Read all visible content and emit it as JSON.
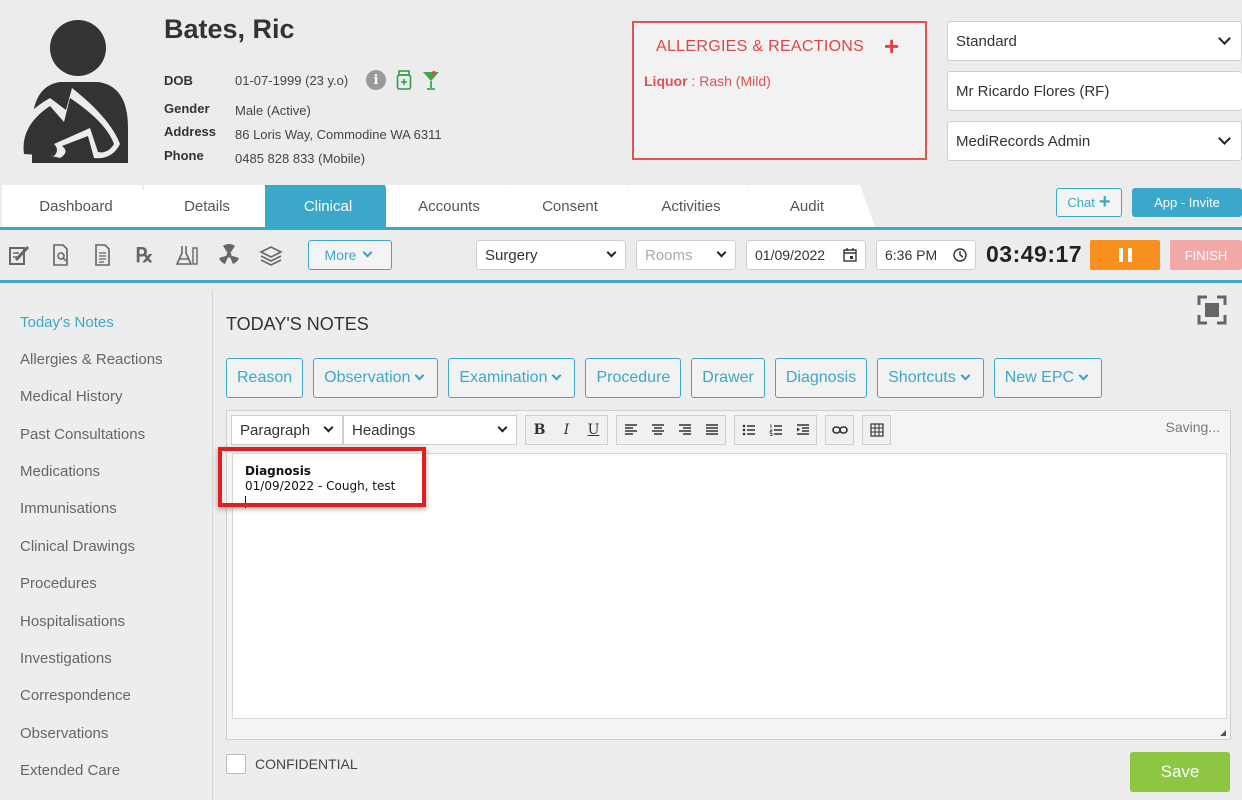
{
  "patient": {
    "name": "Bates, Ric",
    "dob_label": "DOB",
    "dob": "01-07-1999 (23 y.o)",
    "gender_label": "Gender",
    "gender": "Male (Active)",
    "address_label": "Address",
    "address": "86 Loris Way, Commodine WA 6311",
    "phone_label": "Phone",
    "phone": "0485 828 833 (Mobile)",
    "icons": [
      "info-icon",
      "medication-jar-icon",
      "cocktail-icon"
    ]
  },
  "allergies": {
    "title": "ALLERGIES & REACTIONS",
    "items": [
      {
        "name": "Liquor",
        "sep": " : ",
        "reaction": "Rash (Mild)"
      }
    ]
  },
  "header_selects": {
    "template": "Standard",
    "doctor": "Mr Ricardo Flores (RF)",
    "role": "MediRecords Admin"
  },
  "tabs": [
    "Dashboard",
    "Details",
    "Clinical",
    "Accounts",
    "Consent",
    "Activities",
    "Audit"
  ],
  "active_tab": "Clinical",
  "header_buttons": {
    "chat": "Chat",
    "invite": "App - Invite"
  },
  "toolbar": {
    "icons": [
      "note-edit-icon",
      "document-search-icon",
      "document-list-icon",
      "rx-icon",
      "lab-flask-icon",
      "radiation-icon",
      "stack-books-icon"
    ],
    "more": "More",
    "location": "Surgery",
    "rooms_placeholder": "Rooms",
    "date": "01/09/2022",
    "time": "6:36 PM",
    "timer": "03:49:17",
    "finish": "FINISH"
  },
  "sidebar": {
    "items": [
      "Today's Notes",
      "Allergies & Reactions",
      "Medical History",
      "Past Consultations",
      "Medications",
      "Immunisations",
      "Clinical Drawings",
      "Procedures",
      "Hospitalisations",
      "Investigations",
      "Correspondence",
      "Observations",
      "Extended Care"
    ],
    "active": "Today's Notes"
  },
  "notes": {
    "title": "TODAY'S NOTES",
    "buttons": [
      {
        "label": "Reason",
        "dropdown": false
      },
      {
        "label": "Observation",
        "dropdown": true
      },
      {
        "label": "Examination",
        "dropdown": true
      },
      {
        "label": "Procedure",
        "dropdown": false
      },
      {
        "label": "Drawer",
        "dropdown": false
      },
      {
        "label": "Diagnosis",
        "dropdown": false
      },
      {
        "label": "Shortcuts",
        "dropdown": true
      },
      {
        "label": "New EPC",
        "dropdown": true
      }
    ],
    "editor": {
      "block_format": "Paragraph",
      "headings": "Headings",
      "status": "Saving...",
      "content_heading": "Diagnosis",
      "content_line": "01/09/2022 - Cough, test"
    },
    "confidential_label": "CONFIDENTIAL",
    "save": "Save"
  },
  "colors": {
    "accent": "#3ba8c9",
    "allergy": "#e05353",
    "pause": "#f7901e",
    "finish": "#f3a8a8",
    "save": "#8dc641",
    "highlight": "#e02020"
  }
}
